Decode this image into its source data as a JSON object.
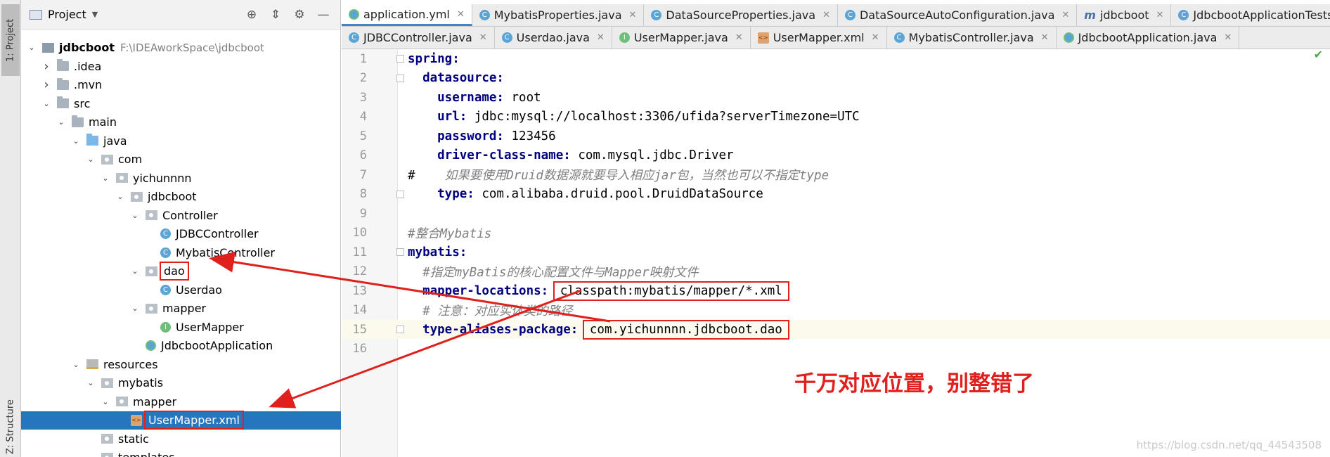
{
  "toolstrip": {
    "project_label": "1: Project",
    "structure_label": "Z: Structure"
  },
  "project_panel": {
    "title": "Project",
    "tree": [
      {
        "label": "jdbcboot",
        "path": "F:\\IDEAworkSpace\\jdbcboot",
        "icon": "module-icon",
        "expanded": true
      },
      {
        "label": ".idea",
        "icon": "folder-icon",
        "expanded": false
      },
      {
        "label": ".mvn",
        "icon": "folder-icon",
        "expanded": false
      },
      {
        "label": "src",
        "icon": "folder-icon",
        "expanded": true
      },
      {
        "label": "main",
        "icon": "folder-icon",
        "expanded": true
      },
      {
        "label": "java",
        "icon": "source-folder-icon",
        "expanded": true
      },
      {
        "label": "com",
        "icon": "package-icon",
        "expanded": true
      },
      {
        "label": "yichunnnn",
        "icon": "package-icon",
        "expanded": true
      },
      {
        "label": "jdbcboot",
        "icon": "package-icon",
        "expanded": true
      },
      {
        "label": "Controller",
        "icon": "package-icon",
        "expanded": true
      },
      {
        "label": "JDBCController",
        "icon": "class-icon"
      },
      {
        "label": "MybatisController",
        "icon": "class-icon"
      },
      {
        "label": "dao",
        "icon": "package-icon",
        "expanded": true,
        "boxed": true
      },
      {
        "label": "Userdao",
        "icon": "class-icon"
      },
      {
        "label": "mapper",
        "icon": "package-icon",
        "expanded": true
      },
      {
        "label": "UserMapper",
        "icon": "interface-icon"
      },
      {
        "label": "JdbcbootApplication",
        "icon": "spring-class-icon"
      },
      {
        "label": "resources",
        "icon": "resources-folder-icon",
        "expanded": true
      },
      {
        "label": "mybatis",
        "icon": "package-icon",
        "expanded": true
      },
      {
        "label": "mapper",
        "icon": "package-icon",
        "expanded": true
      },
      {
        "label": "UserMapper.xml",
        "icon": "xml-file-icon",
        "selected": true,
        "boxed": true
      },
      {
        "label": "static",
        "icon": "package-icon"
      },
      {
        "label": "templates",
        "icon": "package-icon"
      }
    ]
  },
  "tabs_row1": [
    {
      "label": "application.yml",
      "icon": "yml-icon",
      "active": true
    },
    {
      "label": "MybatisProperties.java",
      "icon": "class-icon"
    },
    {
      "label": "DataSourceProperties.java",
      "icon": "class-icon"
    },
    {
      "label": "DataSourceAutoConfiguration.java",
      "icon": "class-icon"
    },
    {
      "label": "jdbcboot",
      "icon": "maven-icon"
    },
    {
      "label": "JdbcbootApplicationTests.java",
      "icon": "class-icon"
    }
  ],
  "tabs_row2": [
    {
      "label": "JDBCController.java",
      "icon": "class-icon"
    },
    {
      "label": "Userdao.java",
      "icon": "class-icon"
    },
    {
      "label": "UserMapper.java",
      "icon": "interface-icon"
    },
    {
      "label": "UserMapper.xml",
      "icon": "xml-file-icon"
    },
    {
      "label": "MybatisController.java",
      "icon": "class-icon"
    },
    {
      "label": "JdbcbootApplication.java",
      "icon": "spring-class-icon"
    }
  ],
  "editor": {
    "lines": [
      {
        "n": "1",
        "parts": [
          {
            "t": "spring:",
            "c": "key"
          }
        ],
        "fold": true
      },
      {
        "n": "2",
        "parts": [
          {
            "t": "  datasource:",
            "c": "key"
          }
        ],
        "fold": true
      },
      {
        "n": "3",
        "parts": [
          {
            "t": "    username:",
            "c": "key"
          },
          {
            "t": " root",
            "c": "val"
          }
        ]
      },
      {
        "n": "4",
        "parts": [
          {
            "t": "    url:",
            "c": "key"
          },
          {
            "t": " jdbc:mysql://localhost:3306/ufida?serverTimezone=UTC",
            "c": "val"
          }
        ]
      },
      {
        "n": "5",
        "parts": [
          {
            "t": "    password:",
            "c": "key"
          },
          {
            "t": " 123456",
            "c": "val"
          }
        ]
      },
      {
        "n": "6",
        "parts": [
          {
            "t": "    driver-class-name:",
            "c": "key"
          },
          {
            "t": " com.mysql.jdbc.Driver",
            "c": "val"
          }
        ]
      },
      {
        "n": "7",
        "parts": [
          {
            "t": "#",
            "c": "val"
          },
          {
            "t": "    如果要使用Druid数据源就要导入相应jar包，当然也可以不指定type",
            "c": "cmt"
          }
        ]
      },
      {
        "n": "8",
        "parts": [
          {
            "t": "    type:",
            "c": "key"
          },
          {
            "t": " com.alibaba.druid.pool.DruidDataSource",
            "c": "val"
          }
        ],
        "fold": true
      },
      {
        "n": "9",
        "parts": []
      },
      {
        "n": "10",
        "parts": [
          {
            "t": "#整合Mybatis",
            "c": "cmt"
          }
        ]
      },
      {
        "n": "11",
        "parts": [
          {
            "t": "mybatis:",
            "c": "key"
          }
        ],
        "fold": true
      },
      {
        "n": "12",
        "parts": [
          {
            "t": "  #指定myBatis的核心配置文件与Mapper映射文件",
            "c": "cmt"
          }
        ]
      },
      {
        "n": "13",
        "parts": [
          {
            "t": "  mapper-locations:",
            "c": "key"
          },
          {
            "t": " ",
            "c": "val"
          },
          {
            "t": "classpath:mybatis/mapper/*.xml",
            "c": "val",
            "boxed": true
          }
        ]
      },
      {
        "n": "14",
        "parts": [
          {
            "t": "  # 注意：对应实体类的路径",
            "c": "cmt"
          }
        ]
      },
      {
        "n": "15",
        "parts": [
          {
            "t": "  type-aliases-package:",
            "c": "key"
          },
          {
            "t": " ",
            "c": "val"
          },
          {
            "t": "com.yichunnnn.jdbcboot.dao",
            "c": "val",
            "boxed": true
          }
        ],
        "fold": true,
        "highlight": true
      },
      {
        "n": "16",
        "parts": []
      }
    ]
  },
  "annotation": "千万对应位置，别整错了",
  "watermark": "https://blog.csdn.net/qq_44543508",
  "colors": {
    "accent": "#2675bf",
    "annotation_red": "#e0201c",
    "key_navy": "#000080"
  }
}
